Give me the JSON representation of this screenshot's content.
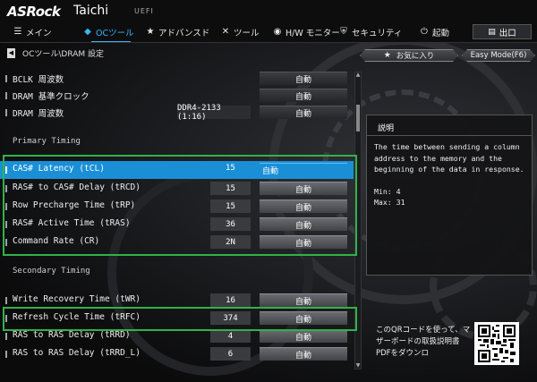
{
  "header": {
    "logo": "ASRock",
    "model": "Taichi",
    "uefi": "UEFI",
    "nav": [
      {
        "label": "メイン",
        "icon": "☰"
      },
      {
        "label": "OCツール",
        "icon": "◆"
      },
      {
        "label": "アドバンスド",
        "icon": "★"
      },
      {
        "label": "ツール",
        "icon": "✕"
      },
      {
        "label": "H/W モニター",
        "icon": "◉"
      },
      {
        "label": "セキュリティ",
        "icon": "⛨"
      },
      {
        "label": "起動",
        "icon": "⏻"
      }
    ],
    "exit": {
      "label": "出口",
      "icon": "▤"
    }
  },
  "breadcrumb": "OCツール\\DRAM 設定",
  "tags": {
    "favorites": "お気に入り",
    "easy_mode": "Easy Mode(F6)"
  },
  "settings_top": [
    {
      "label": "BCLK 周波数",
      "value": "",
      "option": "自動"
    },
    {
      "label": "DRAM 基準クロック",
      "value": "",
      "option": "自動"
    },
    {
      "label": "DRAM 周波数",
      "value": "DDR4-2133 (1:16)",
      "option": "自動"
    }
  ],
  "sections": {
    "primary": "Primary Timing",
    "secondary": "Secondary Timing"
  },
  "primary_timing": [
    {
      "label": "CAS# Latency (tCL)",
      "value": "15",
      "option": "自動"
    },
    {
      "label": "RAS# to CAS# Delay (tRCD)",
      "value": "15",
      "option": "自動"
    },
    {
      "label": "Row Precharge Time (tRP)",
      "value": "15",
      "option": "自動"
    },
    {
      "label": "RAS# Active Time (tRAS)",
      "value": "36",
      "option": "自動"
    },
    {
      "label": "Command Rate (CR)",
      "value": "2N",
      "option": "自動"
    }
  ],
  "secondary_timing": [
    {
      "label": "Write Recovery Time (tWR)",
      "value": "16",
      "option": "自動"
    },
    {
      "label": "Refresh Cycle Time (tRFC)",
      "value": "374",
      "option": "自動"
    },
    {
      "label": "RAS to RAS Delay (tRRD)",
      "value": "4",
      "option": "自動"
    },
    {
      "label": "RAS to RAS Delay (tRRD_L)",
      "value": "6",
      "option": "自動"
    }
  ],
  "description": {
    "title": "説明",
    "text": "The time between sending a column address to the memory and the beginning of the data in response.",
    "min": "Min: 4",
    "max": "Max: 31"
  },
  "qr": {
    "text": "このQRコードを使って、マザーボードの取扱説明書PDFをダウンロ"
  },
  "colors": {
    "accent": "#1a8fd6",
    "nav_active": "#36b6ff",
    "highlight_frame": "#31b24a"
  }
}
